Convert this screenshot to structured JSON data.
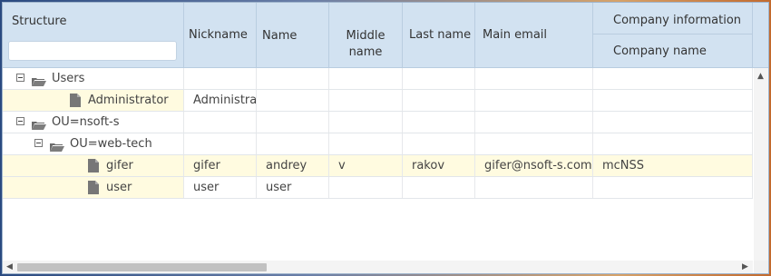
{
  "columns": {
    "structure": "Structure",
    "nickname": "Nickname",
    "name": "Name",
    "middle_name": "Middle name",
    "last_name": "Last name",
    "main_email": "Main email",
    "company_info": "Company information",
    "company_name": "Company name"
  },
  "search": {
    "value": "",
    "placeholder": ""
  },
  "rows": [
    {
      "label": "Users",
      "nickname": "",
      "name": "",
      "middle": "",
      "last": "",
      "email": "",
      "company": "",
      "type": "folder"
    },
    {
      "label": "Administrator",
      "nickname": "Administrat",
      "name": "",
      "middle": "",
      "last": "",
      "email": "",
      "company": "",
      "type": "user"
    },
    {
      "label": "OU=nsoft-s",
      "nickname": "",
      "name": "",
      "middle": "",
      "last": "",
      "email": "",
      "company": "",
      "type": "folder"
    },
    {
      "label": "OU=web-tech",
      "nickname": "",
      "name": "",
      "middle": "",
      "last": "",
      "email": "",
      "company": "",
      "type": "folder"
    },
    {
      "label": "gifer",
      "nickname": "gifer",
      "name": "andrey",
      "middle": "v",
      "last": "rakov",
      "email": "gifer@nsoft-s.com",
      "company": "mcNSS",
      "type": "user"
    },
    {
      "label": "user",
      "nickname": "user",
      "name": "user",
      "middle": "",
      "last": "",
      "email": "",
      "company": "",
      "type": "user"
    }
  ],
  "colors": {
    "header": "#d2e2f1",
    "selected_row": "#fffbe0",
    "grid_line": "#e2e6ea"
  },
  "icons": [
    "collapse-icon",
    "folder-open-icon",
    "file-icon",
    "scroll-left-icon",
    "scroll-right-icon",
    "scroll-up-icon"
  ]
}
